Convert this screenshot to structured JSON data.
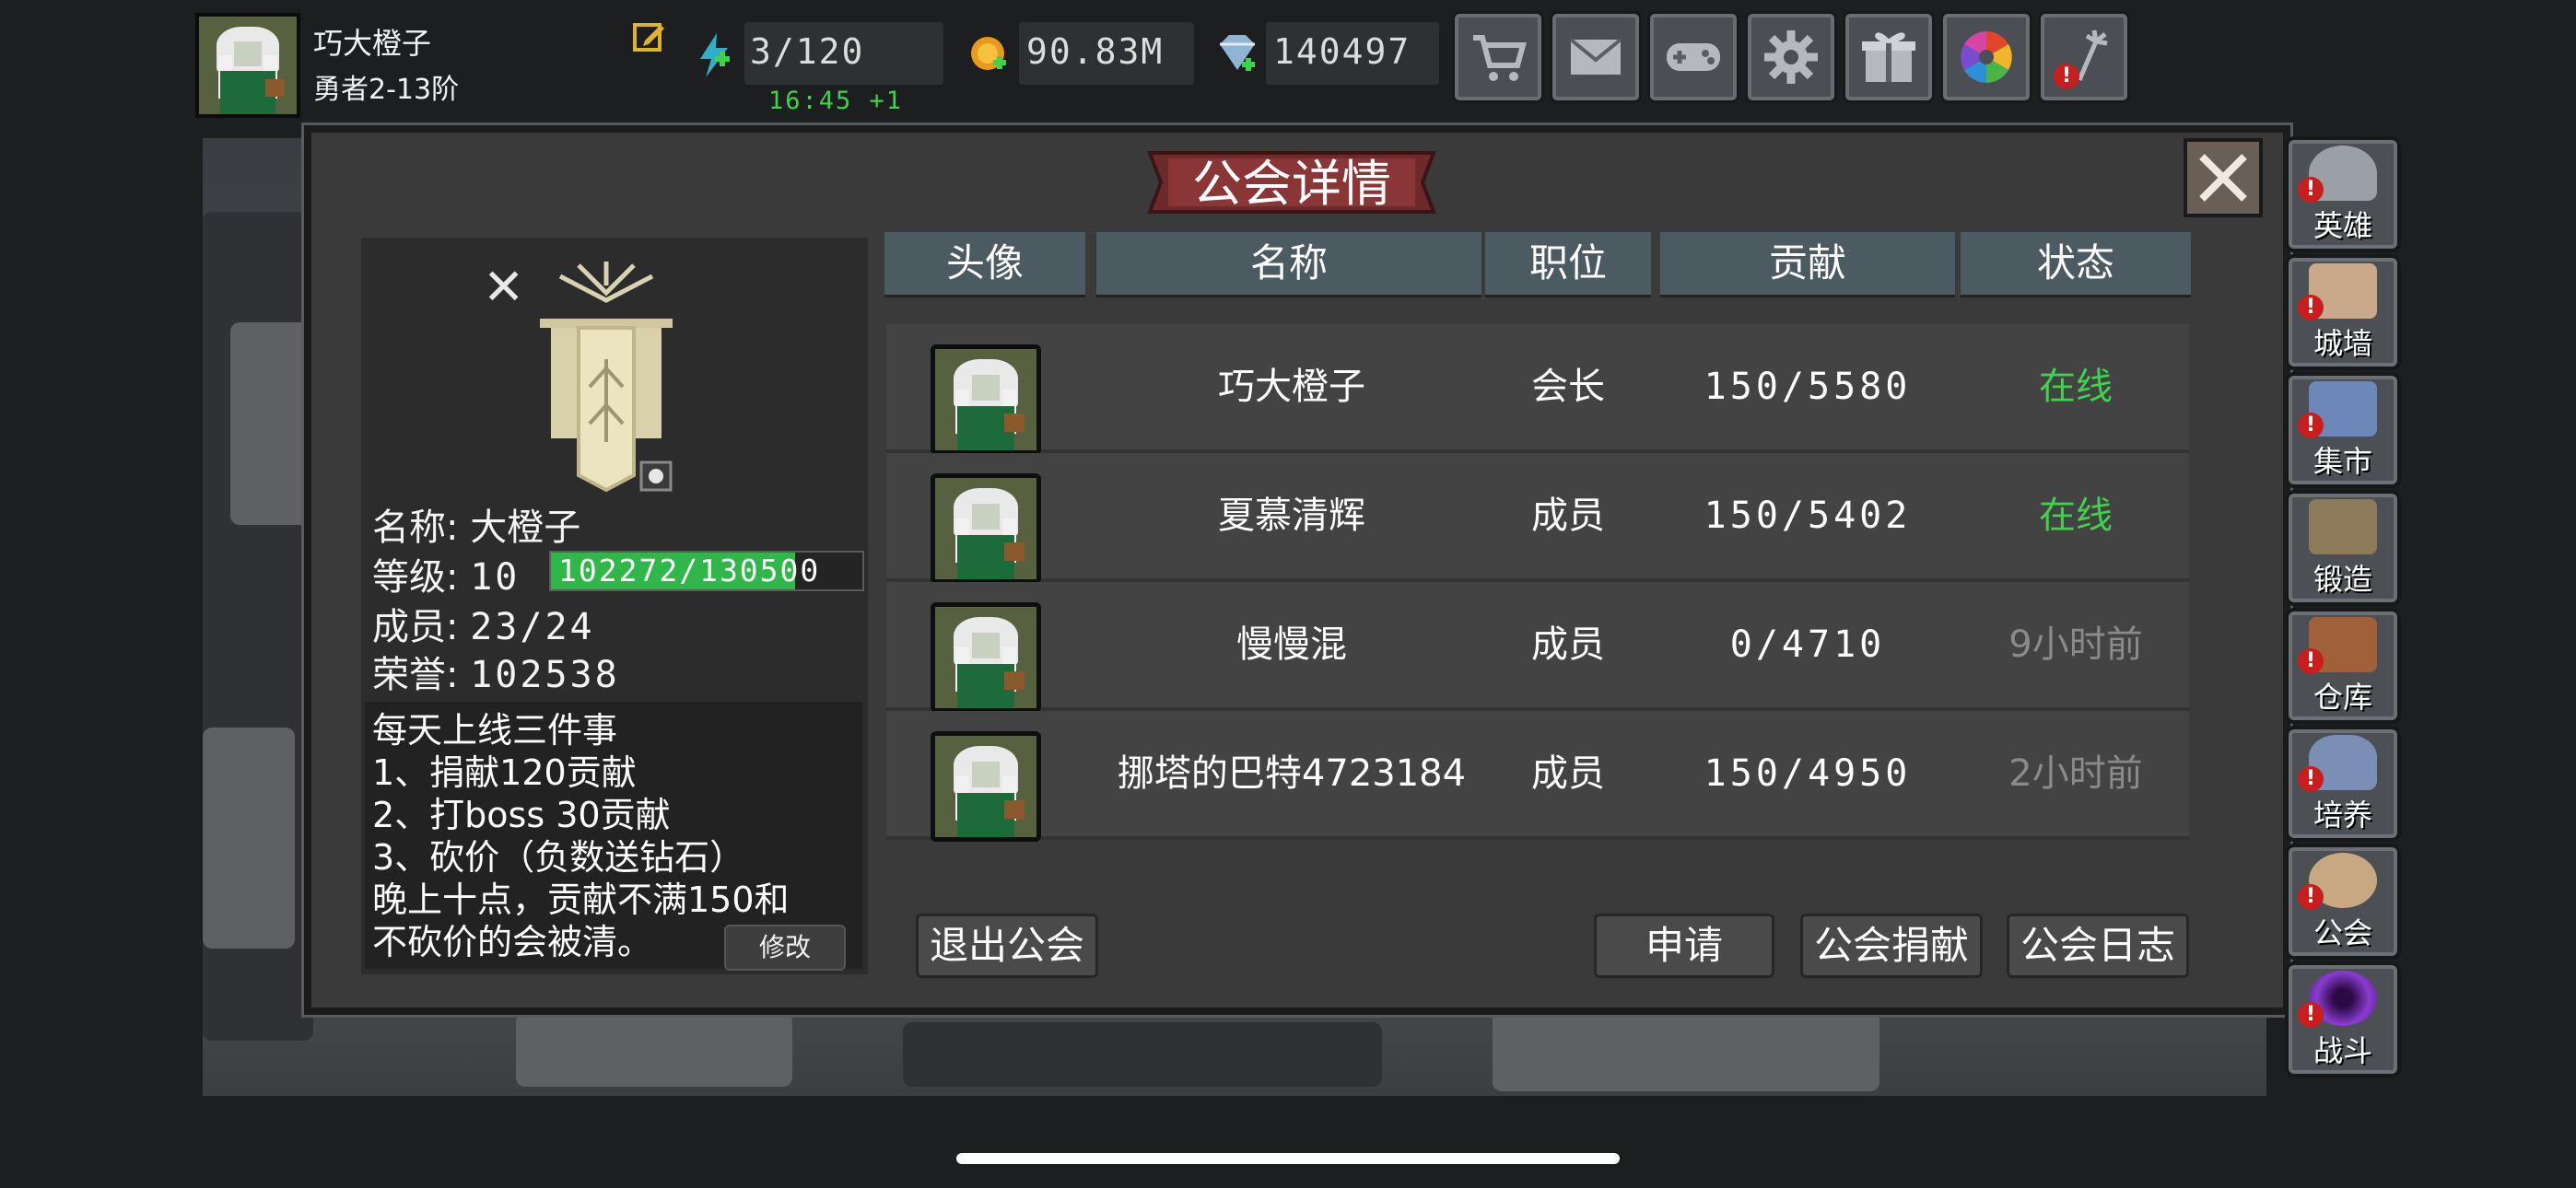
{
  "player": {
    "name": "巧大橙子",
    "rank": "勇者2-13阶"
  },
  "resources": {
    "energy": "3/120",
    "energy_timer": "16:45 +1",
    "gold": "90.83M",
    "diamonds": "140497"
  },
  "top_buttons": [
    "shop-cart-icon",
    "mail-icon",
    "gamepad-icon",
    "settings-gear-icon",
    "gift-icon",
    "color-wheel-icon",
    "fireworks-icon"
  ],
  "panel": {
    "title": "公会详情"
  },
  "guild": {
    "name_label": "名称:",
    "name": "大橙子",
    "level_label": "等级:",
    "level": "10",
    "progress_text": "102272/130500",
    "progress_value": 102272,
    "progress_max": 130500,
    "members_label": "成员:",
    "members": "23/24",
    "honor_label": "荣誉:",
    "honor": "102538",
    "notice": [
      "每天上线三件事",
      "1、捐献120贡献",
      "2、打boss 30贡献",
      "3、砍价（负数送钻石）",
      "晚上十点，贡献不满150和",
      "不砍价的会被清。"
    ],
    "edit_label": "修改"
  },
  "table": {
    "headers": [
      "头像",
      "名称",
      "职位",
      "贡献",
      "状态"
    ],
    "rows": [
      {
        "name": "巧大橙子",
        "role": "会长",
        "contribution": "150/5580",
        "status": "在线",
        "online": true
      },
      {
        "name": "夏慕清辉",
        "role": "成员",
        "contribution": "150/5402",
        "status": "在线",
        "online": true
      },
      {
        "name": "慢慢混",
        "role": "成员",
        "contribution": "0/4710",
        "status": "9小时前",
        "online": false
      },
      {
        "name": "挪塔的巴特4723184",
        "role": "成员",
        "contribution": "150/4950",
        "status": "2小时前",
        "online": false
      }
    ]
  },
  "buttons": {
    "leave": "退出公会",
    "apply": "申请",
    "donate": "公会捐献",
    "log": "公会日志"
  },
  "sidebar": [
    "英雄",
    "城墙",
    "集市",
    "锻造",
    "仓库",
    "培养",
    "公会",
    "战斗"
  ],
  "colors": {
    "online": "#3fd24a",
    "offline": "#8a8a8a",
    "alert": "#c81e1e"
  }
}
